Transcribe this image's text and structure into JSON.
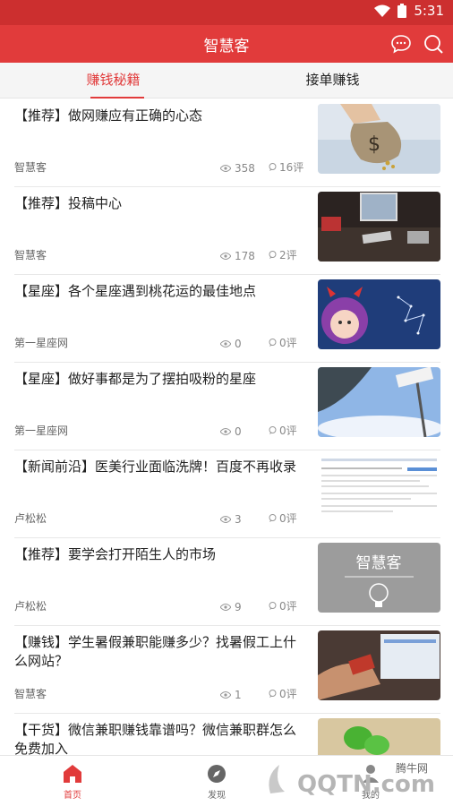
{
  "status": {
    "time": "5:31"
  },
  "app": {
    "title": "智慧客"
  },
  "tabs": [
    {
      "label": "赚钱秘籍",
      "active": true
    },
    {
      "label": "接单赚钱",
      "active": false
    }
  ],
  "articles": [
    {
      "title": "【推荐】做网赚应有正确的心态",
      "author": "智慧客",
      "views": "358",
      "comments": "16评",
      "thumb": "money-bag"
    },
    {
      "title": "【推荐】投稿中心",
      "author": "智慧客",
      "views": "178",
      "comments": "2评",
      "thumb": "desk"
    },
    {
      "title": "【星座】各个星座遇到桃花运的最佳地点",
      "author": "第一星座网",
      "views": "0",
      "comments": "0评",
      "thumb": "cartoon-stars"
    },
    {
      "title": "【星座】做好事都是为了摆拍吸粉的星座",
      "author": "第一星座网",
      "views": "0",
      "comments": "0评",
      "thumb": "sky"
    },
    {
      "title": "【新闻前沿】医美行业面临洗牌！百度不再收录",
      "author": "卢松松",
      "views": "3",
      "comments": "0评",
      "thumb": "webpage"
    },
    {
      "title": "【推荐】要学会打开陌生人的市场",
      "author": "卢松松",
      "views": "9",
      "comments": "0评",
      "thumb": "zhihuike-logo"
    },
    {
      "title": "【赚钱】学生暑假兼职能赚多少？找暑假工上什么网站？",
      "author": "智慧客",
      "views": "1",
      "comments": "0评",
      "thumb": "card-payment"
    },
    {
      "title": "【干货】微信兼职赚钱靠谱吗？微信兼职群怎么免费加入",
      "author": "",
      "views": "",
      "comments": "",
      "thumb": "wechat"
    }
  ],
  "thumb_text": {
    "logo": "智慧客"
  },
  "bottom_nav": [
    {
      "label": "首页",
      "icon": "home-icon",
      "active": true
    },
    {
      "label": "发现",
      "icon": "compass-icon",
      "active": false
    },
    {
      "label": "我的",
      "icon": "user-icon",
      "active": false
    }
  ],
  "watermark": {
    "text": "腾牛网",
    "brand": "QQTN.com"
  },
  "colors": {
    "accent": "#e13b3b",
    "statusbar": "#cc2f2f"
  }
}
